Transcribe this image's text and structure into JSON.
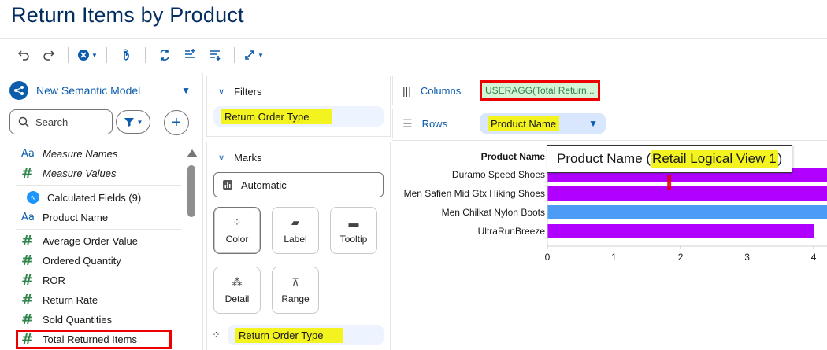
{
  "page": {
    "title": "Return Items by Product"
  },
  "toolbar": {
    "icons": [
      "undo-icon",
      "redo-icon",
      "clear-icon",
      "touch-icon",
      "swap-icon",
      "sort-asc-icon",
      "sort-desc-icon",
      "fit-icon"
    ]
  },
  "left": {
    "model_label": "New Semantic Model",
    "search_placeholder": "Search",
    "fields_top": [
      {
        "type": "text",
        "icon": "Aa",
        "label": "Measure Names"
      },
      {
        "type": "number",
        "icon": "#",
        "label": "Measure Values"
      }
    ],
    "calc_label": "Calculated Fields (9)",
    "fields": [
      {
        "type": "text",
        "icon": "Aa",
        "label": "Product Name"
      },
      {
        "type": "number",
        "icon": "#",
        "label": "Average Order Value"
      },
      {
        "type": "number",
        "icon": "#",
        "label": "Ordered Quantity"
      },
      {
        "type": "number",
        "icon": "#",
        "label": "ROR"
      },
      {
        "type": "number",
        "icon": "#",
        "label": "Return Rate"
      },
      {
        "type": "number",
        "icon": "#",
        "label": "Sold Quantities"
      },
      {
        "type": "number",
        "icon": "#",
        "label": "Total Returned Items"
      }
    ]
  },
  "filters": {
    "title": "Filters",
    "pill": "Return Order Type"
  },
  "marks": {
    "title": "Marks",
    "type": "Automatic",
    "cards": [
      "Color",
      "Label",
      "Tooltip",
      "Detail",
      "Range"
    ],
    "pill": "Return Order Type"
  },
  "shelves": {
    "columns_label": "Columns",
    "columns_pill": "USERAGG(Total Return...",
    "rows_label": "Rows",
    "rows_pill": "Product Name"
  },
  "tooltip": {
    "prefix": "Product Name (",
    "highlight": "Retail Logical View 1",
    "suffix": ")"
  },
  "colors": {
    "purple": "#b000ff",
    "blue": "#4c9bf5",
    "accent": "#0b5cab",
    "highlight": "#f3f31f",
    "red": "#e00000"
  },
  "chart_data": {
    "type": "bar",
    "orientation": "horizontal",
    "title": "",
    "ylabel": "Product Name",
    "xlabel": "",
    "categories": [
      "Duramo Speed Shoes",
      "Men Safien Mid Gtx Hiking Shoes",
      "Men Chilkat Nylon Boots",
      "UltraRunBreeze"
    ],
    "values": [
      4.2,
      4.2,
      4.2,
      4.0
    ],
    "bar_colors": [
      "#b000ff",
      "#b000ff",
      "#4c9bf5",
      "#b000ff"
    ],
    "xticks": [
      0,
      1,
      2,
      3,
      4
    ],
    "xlim": [
      0,
      4.2
    ],
    "grid": false
  }
}
